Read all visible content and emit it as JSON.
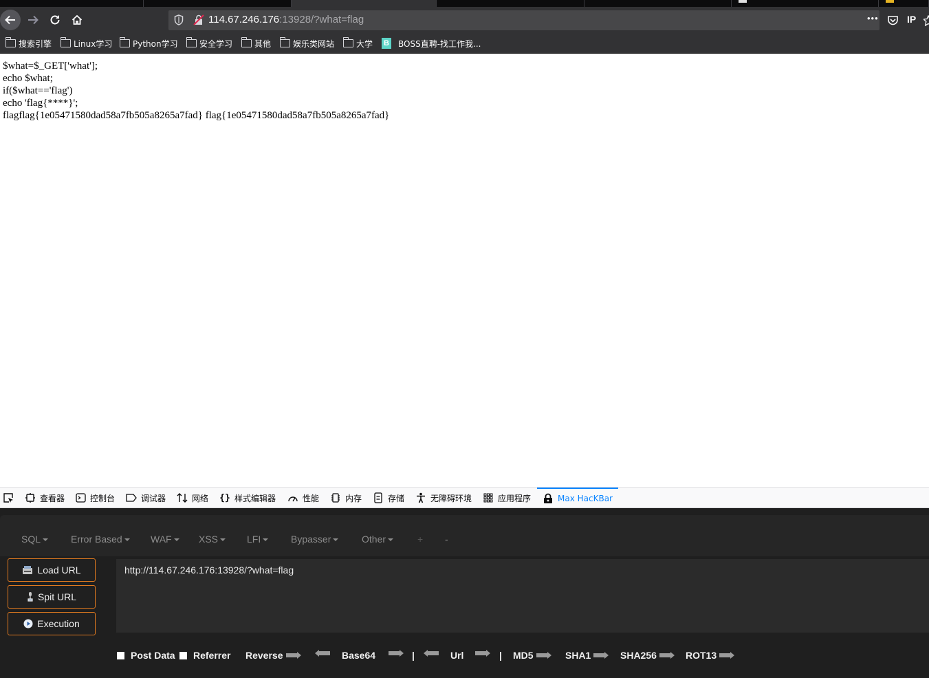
{
  "browser": {
    "url": {
      "host": "114.67.246.176",
      "rest": ":13928/?what=flag"
    },
    "ip_label": "IP",
    "more_label": "•••"
  },
  "bookmarks": [
    {
      "label": "搜索引擎",
      "icon": "folder-icon"
    },
    {
      "label": "Linux学习",
      "icon": "folder-icon"
    },
    {
      "label": "Python学习",
      "icon": "folder-icon"
    },
    {
      "label": "安全学习",
      "icon": "folder-icon"
    },
    {
      "label": "其他",
      "icon": "folder-icon"
    },
    {
      "label": "娱乐类网站",
      "icon": "folder-icon"
    },
    {
      "label": "大学",
      "icon": "folder-icon"
    },
    {
      "label": "BOSS直聘-找工作我...",
      "icon": "boss-icon",
      "icon_letter": "B"
    }
  ],
  "page": {
    "lines": [
      "$what=$_GET['what'];",
      "echo $what;",
      "if($what=='flag')",
      "echo 'flag{****}';",
      "flagflag{1e05471580dad58a7fb505a8265a7fad} flag{1e05471580dad58a7fb505a8265a7fad}"
    ]
  },
  "devtools": {
    "tabs": [
      {
        "label": "查看器",
        "icon": "inspector-icon"
      },
      {
        "label": "控制台",
        "icon": "console-icon"
      },
      {
        "label": "调试器",
        "icon": "debugger-icon"
      },
      {
        "label": "网络",
        "icon": "network-icon"
      },
      {
        "label": "样式编辑器",
        "icon": "style-editor-icon"
      },
      {
        "label": "性能",
        "icon": "performance-icon"
      },
      {
        "label": "内存",
        "icon": "memory-icon"
      },
      {
        "label": "存储",
        "icon": "storage-icon"
      },
      {
        "label": "无障碍环境",
        "icon": "accessibility-icon"
      },
      {
        "label": "应用程序",
        "icon": "application-icon"
      },
      {
        "label": "Max HacKBar",
        "icon": "hackbar-icon",
        "active": true
      }
    ],
    "active_color": "#0a84ff"
  },
  "hackbar": {
    "menu": [
      {
        "label": "SQL",
        "dropdown": true
      },
      {
        "label": "Error Based",
        "dropdown": true
      },
      {
        "label": "WAF",
        "dropdown": true
      },
      {
        "label": "XSS",
        "dropdown": true
      },
      {
        "label": "LFI",
        "dropdown": true
      },
      {
        "label": "Bypasser",
        "dropdown": true
      },
      {
        "label": "Other",
        "dropdown": true
      },
      {
        "label": "+",
        "dropdown": false
      },
      {
        "label": "-",
        "dropdown": false
      }
    ],
    "buttons": {
      "load_url": "Load URL",
      "split_url": "Spit URL",
      "execution": "Execution"
    },
    "url_value": "http://114.67.246.176:13928/?what=flag",
    "options": {
      "post_data": "Post Data",
      "referrer": "Referrer",
      "reverse": "Reverse",
      "base64": "Base64",
      "sep": "|",
      "url": "Url",
      "md5": "MD5",
      "sha1": "SHA1",
      "sha256": "SHA256",
      "rot13": "ROT13"
    },
    "accent": "#e07a1f"
  }
}
